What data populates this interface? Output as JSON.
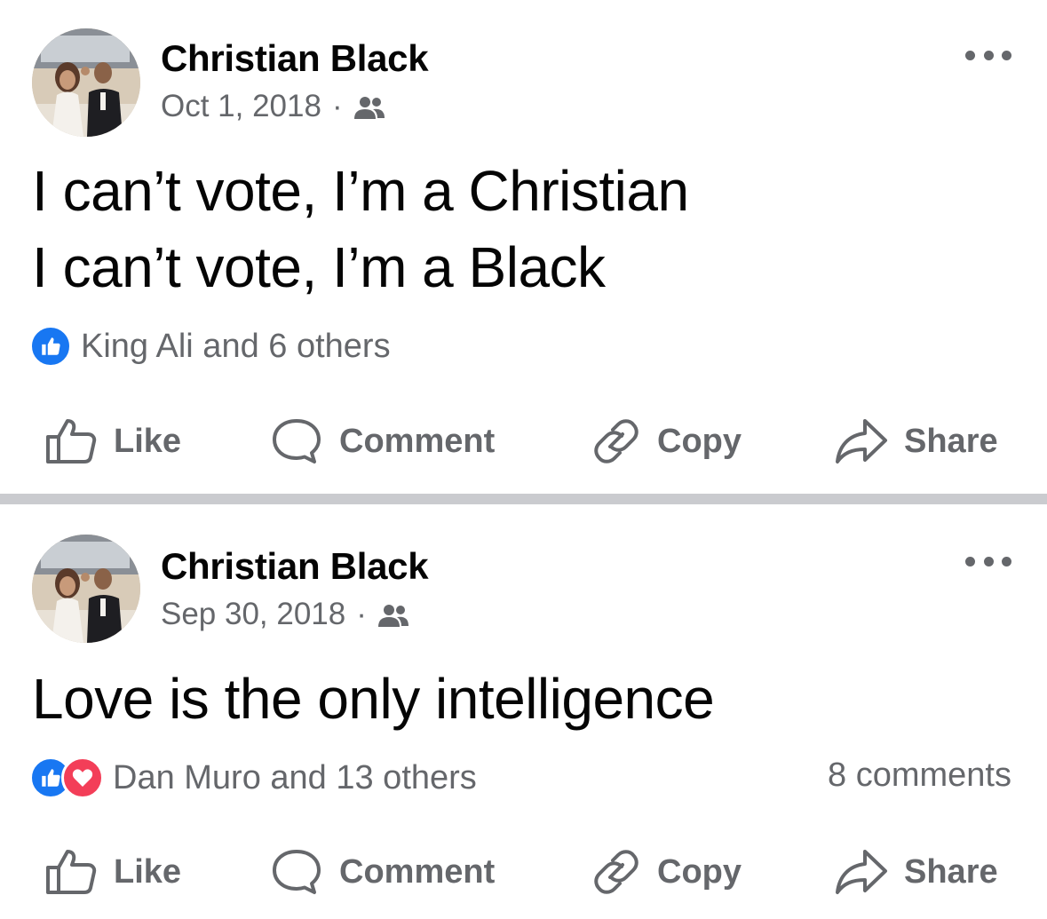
{
  "posts": [
    {
      "author": "Christian Black",
      "date": "Oct 1, 2018",
      "separator": "·",
      "audience_icon": "friends-icon",
      "text_lines": [
        "I can’t vote, I’m a Christian",
        "I can’t vote, I’m a Black"
      ],
      "reaction_icons": [
        "like-reaction-icon"
      ],
      "reactions_text": "King Ali and 6 others",
      "comments_text": "",
      "actions": {
        "like": "Like",
        "comment": "Comment",
        "copy": "Copy",
        "share": "Share"
      }
    },
    {
      "author": "Christian Black",
      "date": "Sep 30, 2018",
      "separator": "·",
      "audience_icon": "friends-icon",
      "text_lines": [
        "Love is the only intelligence"
      ],
      "reaction_icons": [
        "like-reaction-icon",
        "love-reaction-icon"
      ],
      "reactions_text": "Dan Muro and 13 others",
      "comments_text": "8 comments",
      "actions": {
        "like": "Like",
        "comment": "Comment",
        "copy": "Copy",
        "share": "Share"
      }
    }
  ],
  "colors": {
    "like_blue": "#1877f2",
    "love_red": "#f33e58",
    "secondary_text": "#65676b",
    "separator": "#cacbcf"
  }
}
